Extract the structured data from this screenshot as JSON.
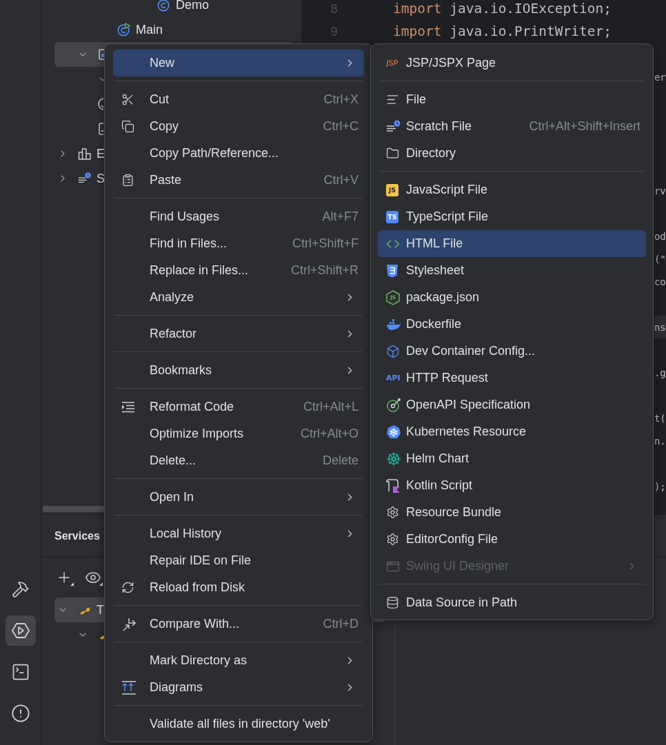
{
  "tool_strip": [
    {
      "selected": false
    },
    {
      "selected": true
    },
    {
      "selected": false
    },
    {
      "selected": false
    }
  ],
  "project_tree": [
    {
      "children": [
        {
          "children": [
            {
              "children": [
                {
                  "children": [
                    {
                      "label": "Demo",
                      "kind": "class"
                    }
                  ]
                }
              ]
            },
            {
              "label": "Main",
              "kind": "main"
            }
          ]
        },
        {
          "kind": "module",
          "expanded": true,
          "selected": true,
          "children": [
            {
              "expanded": true
            }
          ]
        },
        {
          "kind": "web"
        },
        {
          "kind": "xml"
        }
      ]
    },
    {
      "label": "E",
      "kind": "libraries",
      "expanded": false,
      "selected": false
    },
    {
      "label": "S",
      "kind": "scratches",
      "expanded": false,
      "selected": false
    }
  ],
  "editor": {
    "rows": [
      {
        "number": "8",
        "code": "import java.io.IOException;"
      },
      {
        "number": "9",
        "code": "import java.io.PrintWriter;"
      },
      {},
      {
        "tail": "er"
      },
      {},
      {},
      {},
      {},
      {
        "tail": "rv"
      },
      {},
      {
        "tail": "od"
      },
      {
        "tail": "(\""
      },
      {
        "tail": "co"
      },
      {},
      {
        "tail": "ns",
        "highlighted": true
      },
      {},
      {
        "tail": ".g"
      },
      {},
      {
        "tail": "t("
      },
      {
        "tail": "n."
      },
      {},
      {
        "tail": ");"
      }
    ]
  },
  "services": {
    "title": "Services",
    "tree": [
      {
        "label": "T",
        "selected": true,
        "expanded": true,
        "children": [
          {
            "expanded": true,
            "selected": false
          }
        ]
      }
    ]
  },
  "context_menu": {
    "items": [
      {
        "kind": "item",
        "label": "New",
        "submenu": true,
        "selected": true,
        "disabled": false
      },
      {
        "kind": "separator"
      },
      {
        "kind": "item",
        "label": "Cut",
        "shortcut": "Ctrl+X",
        "submenu": false,
        "selected": false,
        "disabled": false
      },
      {
        "kind": "item",
        "label": "Copy",
        "shortcut": "Ctrl+C",
        "submenu": false,
        "selected": false,
        "disabled": false
      },
      {
        "kind": "item",
        "label": "Copy Path/Reference...",
        "submenu": false,
        "selected": false,
        "disabled": false
      },
      {
        "kind": "item",
        "label": "Paste",
        "shortcut": "Ctrl+V",
        "submenu": false,
        "selected": false,
        "disabled": false
      },
      {
        "kind": "separator"
      },
      {
        "kind": "item",
        "label": "Find Usages",
        "shortcut": "Alt+F7",
        "submenu": false,
        "selected": false,
        "disabled": false
      },
      {
        "kind": "item",
        "label": "Find in Files...",
        "shortcut": "Ctrl+Shift+F",
        "submenu": false,
        "selected": false,
        "disabled": false
      },
      {
        "kind": "item",
        "label": "Replace in Files...",
        "shortcut": "Ctrl+Shift+R",
        "submenu": false,
        "selected": false,
        "disabled": false
      },
      {
        "kind": "item",
        "label": "Analyze",
        "submenu": true,
        "selected": false,
        "disabled": false
      },
      {
        "kind": "separator"
      },
      {
        "kind": "item",
        "label": "Refactor",
        "submenu": true,
        "selected": false,
        "disabled": false
      },
      {
        "kind": "separator"
      },
      {
        "kind": "item",
        "label": "Bookmarks",
        "submenu": true,
        "selected": false,
        "disabled": false
      },
      {
        "kind": "separator"
      },
      {
        "kind": "item",
        "label": "Reformat Code",
        "shortcut": "Ctrl+Alt+L",
        "submenu": false,
        "selected": false,
        "disabled": false
      },
      {
        "kind": "item",
        "label": "Optimize Imports",
        "shortcut": "Ctrl+Alt+O",
        "submenu": false,
        "selected": false,
        "disabled": false
      },
      {
        "kind": "item",
        "label": "Delete...",
        "shortcut": "Delete",
        "submenu": false,
        "selected": false,
        "disabled": false
      },
      {
        "kind": "separator"
      },
      {
        "kind": "item",
        "label": "Open In",
        "submenu": true,
        "selected": false,
        "disabled": false
      },
      {
        "kind": "separator"
      },
      {
        "kind": "item",
        "label": "Local History",
        "submenu": true,
        "selected": false,
        "disabled": false
      },
      {
        "kind": "item",
        "label": "Repair IDE on File",
        "submenu": false,
        "selected": false,
        "disabled": false
      },
      {
        "kind": "item",
        "label": "Reload from Disk",
        "submenu": false,
        "selected": false,
        "disabled": false
      },
      {
        "kind": "separator"
      },
      {
        "kind": "item",
        "label": "Compare With...",
        "shortcut": "Ctrl+D",
        "submenu": false,
        "selected": false,
        "disabled": false
      },
      {
        "kind": "separator"
      },
      {
        "kind": "item",
        "label": "Mark Directory as",
        "submenu": true,
        "selected": false,
        "disabled": false
      },
      {
        "kind": "item",
        "label": "Diagrams",
        "submenu": true,
        "selected": false,
        "disabled": false
      },
      {
        "kind": "separator"
      },
      {
        "kind": "item",
        "label": "Validate all files in directory 'web'",
        "submenu": false,
        "selected": false,
        "disabled": false
      }
    ]
  },
  "new_submenu": {
    "items": [
      {
        "kind": "item",
        "label": "JSP/JSPX Page",
        "icon_text": "JSP",
        "submenu": false,
        "selected": false,
        "disabled": false
      },
      {
        "kind": "separator"
      },
      {
        "kind": "item",
        "label": "File",
        "submenu": false,
        "selected": false,
        "disabled": false
      },
      {
        "kind": "item",
        "label": "Scratch File",
        "shortcut": "Ctrl+Alt+Shift+Insert",
        "submenu": false,
        "selected": false,
        "disabled": false
      },
      {
        "kind": "item",
        "label": "Directory",
        "submenu": false,
        "selected": false,
        "disabled": false
      },
      {
        "kind": "separator"
      },
      {
        "kind": "item",
        "label": "JavaScript File",
        "icon_text": "JS",
        "submenu": false,
        "selected": false,
        "disabled": false
      },
      {
        "kind": "item",
        "label": "TypeScript File",
        "icon_text": "TS",
        "submenu": false,
        "selected": false,
        "disabled": false
      },
      {
        "kind": "item",
        "label": "HTML File",
        "submenu": false,
        "selected": true,
        "disabled": false
      },
      {
        "kind": "item",
        "label": "Stylesheet",
        "submenu": false,
        "selected": false,
        "disabled": false
      },
      {
        "kind": "item",
        "label": "package.json",
        "icon_text": "JS",
        "submenu": false,
        "selected": false,
        "disabled": false
      },
      {
        "kind": "item",
        "label": "Dockerfile",
        "submenu": false,
        "selected": false,
        "disabled": false
      },
      {
        "kind": "item",
        "label": "Dev Container Config...",
        "submenu": false,
        "selected": false,
        "disabled": false
      },
      {
        "kind": "item",
        "label": "HTTP Request",
        "icon_text": "API",
        "submenu": false,
        "selected": false,
        "disabled": false
      },
      {
        "kind": "item",
        "label": "OpenAPI Specification",
        "submenu": false,
        "selected": false,
        "disabled": false
      },
      {
        "kind": "item",
        "label": "Kubernetes Resource",
        "submenu": false,
        "selected": false,
        "disabled": false
      },
      {
        "kind": "item",
        "label": "Helm Chart",
        "submenu": false,
        "selected": false,
        "disabled": false
      },
      {
        "kind": "item",
        "label": "Kotlin Script",
        "submenu": false,
        "selected": false,
        "disabled": false
      },
      {
        "kind": "item",
        "label": "Resource Bundle",
        "submenu": false,
        "selected": false,
        "disabled": false
      },
      {
        "kind": "item",
        "label": "EditorConfig File",
        "submenu": false,
        "selected": false,
        "disabled": false
      },
      {
        "kind": "item",
        "label": "Swing UI Designer",
        "submenu": true,
        "selected": false,
        "disabled": true
      },
      {
        "kind": "separator"
      },
      {
        "kind": "item",
        "label": "Data Source in Path",
        "submenu": false,
        "selected": false,
        "disabled": false
      }
    ]
  }
}
